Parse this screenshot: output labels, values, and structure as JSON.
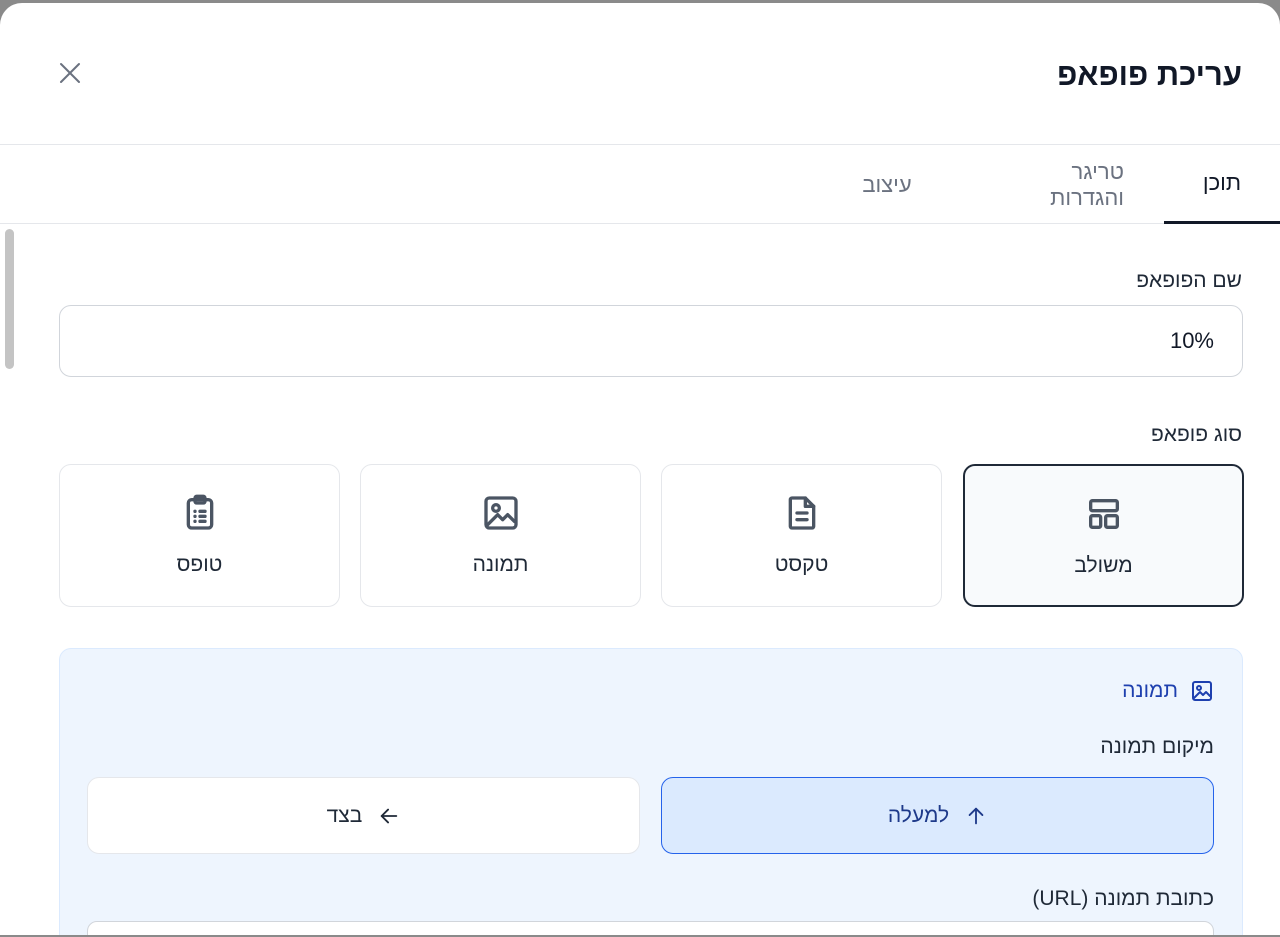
{
  "modal": {
    "title": "עריכת פופאפ",
    "close_icon": "close-icon"
  },
  "tabs": [
    {
      "label": "תוכן",
      "active": true
    },
    {
      "label": "טריגר והגדרות",
      "active": false
    },
    {
      "label": "עיצוב",
      "active": false
    }
  ],
  "popup_name": {
    "label": "שם הפופאפ",
    "value": "10%"
  },
  "popup_type": {
    "label": "סוג פופאפ",
    "options": [
      {
        "label": "משולב",
        "icon": "layout-icon",
        "selected": true
      },
      {
        "label": "טקסט",
        "icon": "document-icon",
        "selected": false
      },
      {
        "label": "תמונה",
        "icon": "image-icon",
        "selected": false
      },
      {
        "label": "טופס",
        "icon": "clipboard-list-icon",
        "selected": false
      }
    ]
  },
  "image_section": {
    "title": "תמונה",
    "icon": "image-icon",
    "position_label": "מיקום תמונה",
    "positions": [
      {
        "label": "למעלה",
        "icon": "arrow-up-icon",
        "selected": true
      },
      {
        "label": "בצד",
        "icon": "arrow-left-icon",
        "selected": false
      }
    ],
    "url_label": "כתובת תמונה (URL)"
  },
  "colors": {
    "accent": "#2563eb",
    "accent_bg": "#dbeafe",
    "panel_bg": "#eef5fe"
  }
}
